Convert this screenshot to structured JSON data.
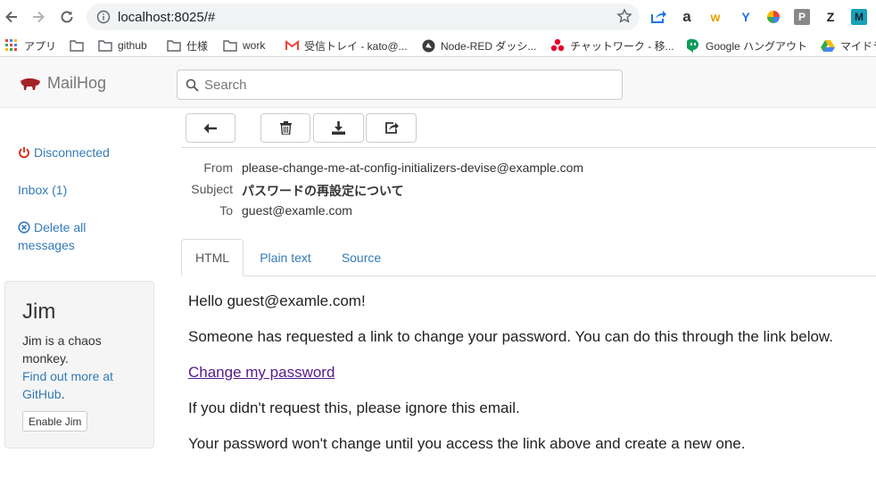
{
  "browser": {
    "url": "localhost:8025/#",
    "bookmarks": [
      {
        "label": "アプリ",
        "icon": "apps-grid-icon"
      },
      {
        "label": "",
        "icon": "folder-icon"
      },
      {
        "label": "github",
        "icon": "folder-icon"
      },
      {
        "label": "仕様",
        "icon": "folder-icon"
      },
      {
        "label": "work",
        "icon": "folder-icon"
      },
      {
        "label": "受信トレイ - kato@...",
        "icon": "gmail-icon"
      },
      {
        "label": "Node-RED ダッシ...",
        "icon": "node-red-icon"
      },
      {
        "label": "チャットワーク - 移...",
        "icon": "chatwork-icon"
      },
      {
        "label": "Google ハングアウト",
        "icon": "hangouts-icon"
      },
      {
        "label": "マイドラ",
        "icon": "google-drive-icon"
      }
    ],
    "extensions": [
      "share-icon",
      "amazon-icon",
      "w-icon",
      "y-icon",
      "color-wheel-icon",
      "p-icon",
      "z-icon",
      "m-icon"
    ]
  },
  "app": {
    "brand": "MailHog",
    "search_placeholder": "Search"
  },
  "sidebar": {
    "status": "Disconnected",
    "inbox": "Inbox (1)",
    "delete_all_line1": "Delete all",
    "delete_all_line2": "messages"
  },
  "jim": {
    "title": "Jim",
    "desc_line1": "Jim is a chaos",
    "desc_line2": "monkey.",
    "link_line1": "Find out more at",
    "link_line2": "GitHub",
    "period": ".",
    "button": "Enable Jim"
  },
  "toolbar": [
    "back-arrow-icon",
    "trash-icon",
    "download-icon",
    "release-icon"
  ],
  "message": {
    "from_label": "From",
    "from": "please-change-me-at-config-initializers-devise@example.com",
    "subject_label": "Subject",
    "subject": "パスワードの再設定について",
    "to_label": "To",
    "to": "guest@examle.com"
  },
  "tabs": [
    {
      "label": "HTML",
      "active": true
    },
    {
      "label": "Plain text",
      "active": false
    },
    {
      "label": "Source",
      "active": false
    }
  ],
  "body": {
    "greeting": "Hello guest@examle.com!",
    "line1": "Someone has requested a link to change your password. You can do this through the link below.",
    "link": "Change my password",
    "line2": "If you didn't request this, please ignore this email.",
    "line3": "Your password won't change until you access the link above and create a new one."
  }
}
